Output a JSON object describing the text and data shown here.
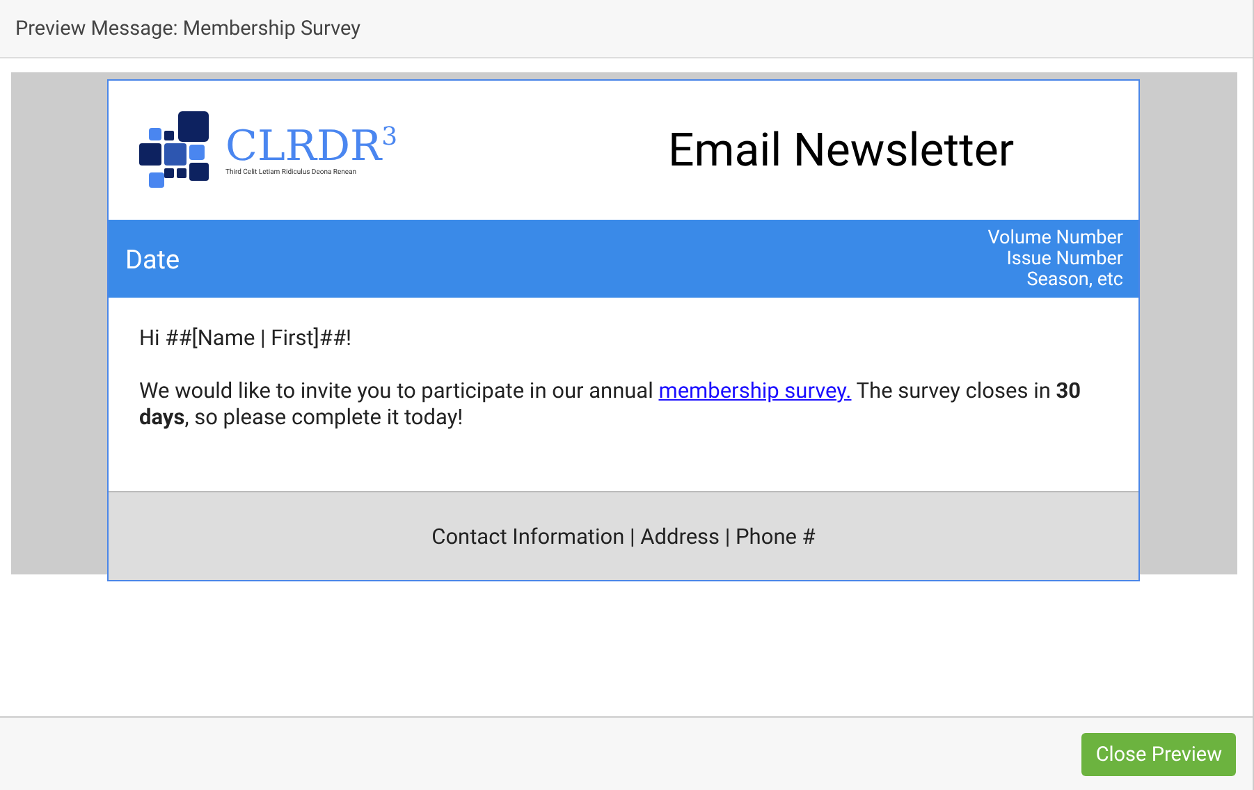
{
  "dialog": {
    "title": "Preview Message: Membership Survey"
  },
  "email": {
    "logo": {
      "name": "CLRDR$^{3}$",
      "tagline": "Third Celit Letiam Ridiculus Deona Renean"
    },
    "heading": "Email Newsletter",
    "banner": {
      "date": "Date",
      "meta": [
        "Volume Number",
        "Issue Number",
        "Season, etc"
      ]
    },
    "greeting": "Hi ##[Name | First]##!",
    "paragraph": {
      "before": "We would like to invite you to participate in our annual ",
      "link": "membership survey.",
      "after": " The survey closes in **30 days**, so please complete it today!"
    },
    "footer": "Contact Information | Address | Phone #"
  },
  "buttons": [
    "Close Preview"
  ]
}
